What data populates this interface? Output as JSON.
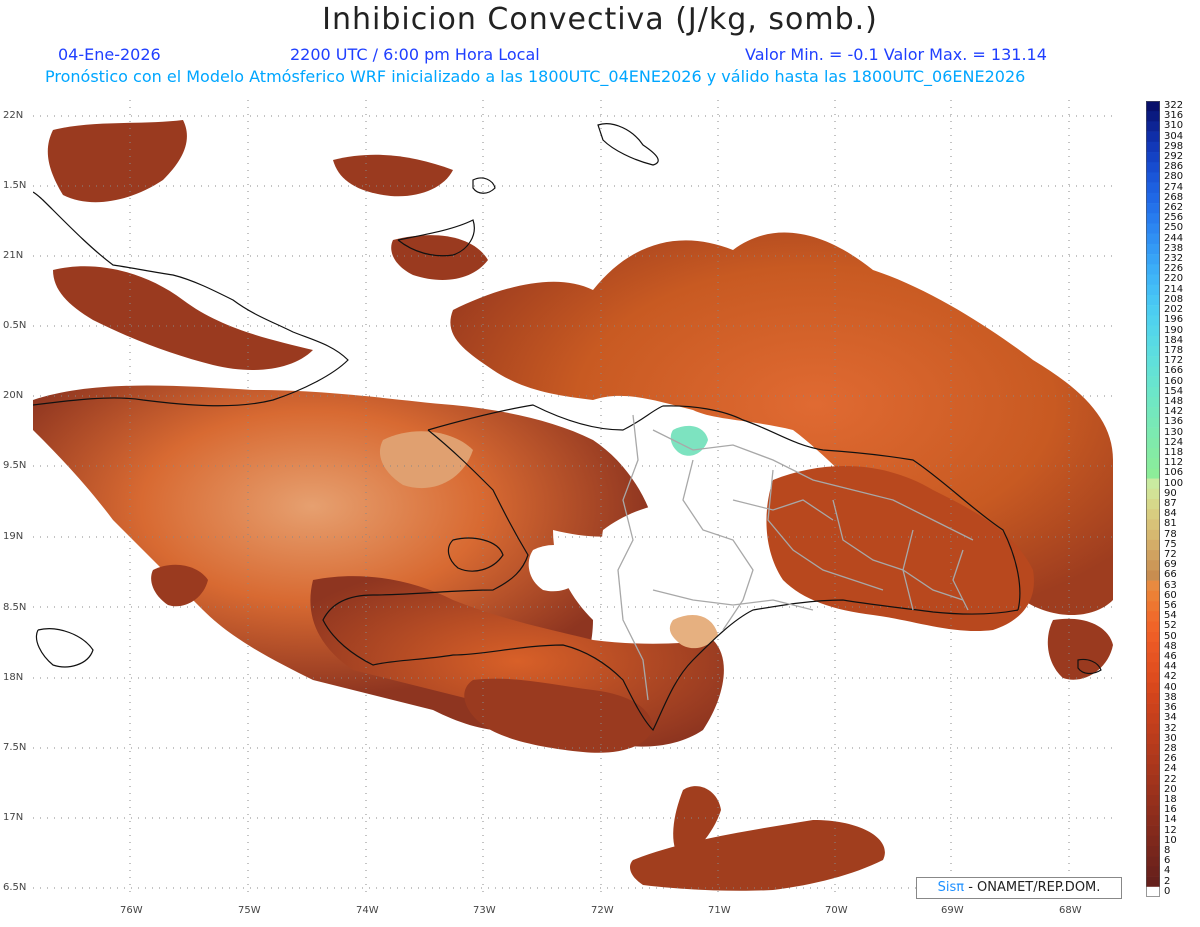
{
  "header": {
    "title": "Inhibicion Convectiva (J/kg, somb.)",
    "date": "04-Ene-2026",
    "time": "2200 UTC / 6:00 pm Hora Local",
    "minmax": "Valor Min. = -0.1   Valor Max. = 131.14",
    "forecast": "Pronóstico con el Modelo Atmósferico WRF inicializado a las 1800UTC_04ENE2026 y válido hasta las  1800UTC_06ENE2026"
  },
  "map": {
    "lat_ticks": [
      "22N",
      "1.5N",
      "21N",
      "0.5N",
      "20N",
      "9.5N",
      "19N",
      "8.5N",
      "18N",
      "7.5N",
      "17N",
      "6.5N"
    ],
    "lon_ticks": [
      "76W",
      "75W",
      "74W",
      "73W",
      "72W",
      "71W",
      "70W",
      "69W",
      "68W"
    ],
    "colors": {
      "low": "#8b3a26",
      "mid": "#c85a20",
      "high": "#e8682a",
      "peak": "#7de3c0",
      "coast": "#111111",
      "borders": "#a8a8a8"
    }
  },
  "colorbar": {
    "labels": [
      "322",
      "316",
      "310",
      "304",
      "298",
      "292",
      "286",
      "280",
      "274",
      "268",
      "262",
      "256",
      "250",
      "244",
      "238",
      "232",
      "226",
      "220",
      "214",
      "208",
      "202",
      "196",
      "190",
      "184",
      "178",
      "172",
      "166",
      "160",
      "154",
      "148",
      "142",
      "136",
      "130",
      "124",
      "118",
      "112",
      "106",
      "100",
      "90",
      "87",
      "84",
      "81",
      "78",
      "75",
      "72",
      "69",
      "66",
      "63",
      "60",
      "56",
      "54",
      "52",
      "50",
      "48",
      "46",
      "44",
      "42",
      "40",
      "38",
      "36",
      "34",
      "32",
      "30",
      "28",
      "26",
      "24",
      "22",
      "20",
      "18",
      "16",
      "14",
      "12",
      "10",
      "8",
      "6",
      "4",
      "2",
      "0"
    ],
    "colors": [
      "#08106b",
      "#0a1a80",
      "#0d2494",
      "#0f2ea8",
      "#1238b8",
      "#1442c4",
      "#174ccf",
      "#1a56d8",
      "#1d60e0",
      "#2068e6",
      "#2472ea",
      "#287cee",
      "#2c86f1",
      "#3090f3",
      "#349af5",
      "#38a4f6",
      "#3caef7",
      "#40b6f7",
      "#44bef6",
      "#48c6f4",
      "#4ccdf1",
      "#50d2ee",
      "#54d6ea",
      "#58dae5",
      "#5cdde0",
      "#60e0db",
      "#64e2d5",
      "#68e4cf",
      "#6ce6c9",
      "#70e7c3",
      "#74e8bd",
      "#78e9b7",
      "#7ceab1",
      "#80eaab",
      "#84eba5",
      "#88ec9f",
      "#8ced99",
      "#c9eaa0",
      "#d2e296",
      "#d6d88a",
      "#d8cd80",
      "#d8c278",
      "#d6b870",
      "#d4ad68",
      "#d0a260",
      "#cc9858",
      "#c88d50",
      "#e88a40",
      "#ec8035",
      "#ee7630",
      "#f06c2c",
      "#f06428",
      "#ee5e26",
      "#ea5824",
      "#e65422",
      "#e25020",
      "#de4c1e",
      "#d8481c",
      "#d2441c",
      "#cc421c",
      "#c6401c",
      "#c03e1c",
      "#ba3c1c",
      "#b43a1c",
      "#ae381c",
      "#a8361c",
      "#a2341c",
      "#9c321c",
      "#96301c",
      "#902e1c",
      "#8a2c1c",
      "#842a1c",
      "#7e281c",
      "#78261c",
      "#72241c",
      "#6c221c",
      "#66201c",
      "#ffffff"
    ]
  },
  "credit": {
    "prefix": "Sis",
    "pi": "π",
    "suffix": "- ONAMET/REP.DOM."
  }
}
